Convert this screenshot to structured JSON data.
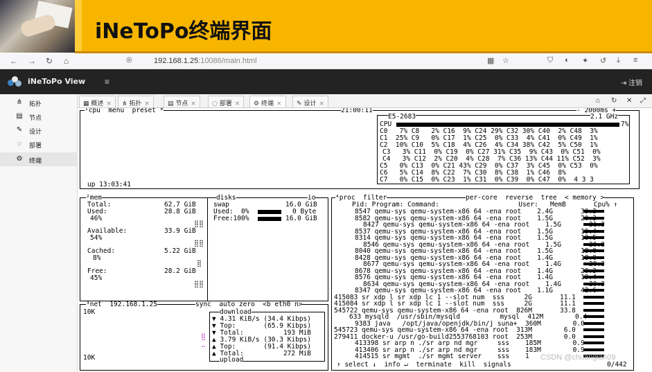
{
  "slide": {
    "title": "iNeToPo终端界面"
  },
  "browser": {
    "url_host": "192.168.1.25",
    "url_path": ":10086/main.html"
  },
  "app": {
    "title": "iNeToPo View",
    "logout": "注销"
  },
  "sidebar": {
    "items": [
      {
        "icon": "topology-icon",
        "label": "拓扑"
      },
      {
        "icon": "node-icon",
        "label": "节点"
      },
      {
        "icon": "design-icon",
        "label": "设计"
      },
      {
        "icon": "deploy-icon",
        "label": "部署"
      },
      {
        "icon": "terminal-icon",
        "label": "终端"
      }
    ]
  },
  "tabs": [
    {
      "label": "概述"
    },
    {
      "label": "拓扑"
    },
    {
      "label": "节点"
    },
    {
      "label": "部署"
    },
    {
      "label": "终端"
    },
    {
      "label": "设计"
    }
  ],
  "term": {
    "cpu_header": "¹cpu  menu  preset *",
    "clock": "21:00:11",
    "interval": "- 2000ms +",
    "cpu_model": "E5-2683",
    "cpu_freq": "2.1 GHz",
    "cpu_total_label": "CPU",
    "cpu_total_pct": "7%",
    "cpu_rows": [
      "C0   7% C8   2% C16  9% C24 29% C32 30% C40  2% C48  3%",
      "C1  25% C9   0% C17  1% C25  0% C33  4% C41  0% C49  1%",
      "C2  10% C10  5% C18  4% C26  4% C34 38% C42  5% C50  1%",
      "C3   3% C11  0% C19  0% C27 31% C35  9% C43  0% C51  0%",
      "C4   3% C12  2% C20  4% C28  7% C36 13% C44 11% C52  3%",
      "C5   0% C13  0% C21 43% C29  0% C37  3% C45  0% C53  0%",
      "C6   5% C14  8% C22  7% C30  8% C38  1% C46  8%",
      "C7   0% C15  0% C23  1% C31  0% C39  0% C47  0%  4 3 3"
    ],
    "uptime": "up 13:03:41",
    "mem_header": "²mem",
    "disks_header": "disks",
    "io_header": "io",
    "mem_rows": [
      {
        "label": "Total:",
        "value": "62.7 GiB"
      },
      {
        "label": "Used:",
        "value": "28.8 GiB",
        "pct": "46%"
      },
      {
        "label": "Available:",
        "value": "33.9 GiB",
        "pct": "54%"
      },
      {
        "label": "Cached:",
        "value": "5.22 GiB",
        "pct": "8%"
      },
      {
        "label": "Free:",
        "value": "28.2 GiB",
        "pct": "45%"
      }
    ],
    "swap_label": "swap",
    "swap_total": "16.0 GiB",
    "swap_used": "Used:  0%",
    "swap_used_val": "0 Byte",
    "swap_free": "Free:100%",
    "swap_free_val": "16.0 GiB",
    "net_header": "³net  192.168.1.25",
    "net_opts": "sync  auto zero  <b eth0 n>",
    "net_top_scale": "10K",
    "net_bottom_scale": "10K",
    "download_label": "download",
    "upload_label": "upload",
    "net_rows": [
      "▼ 4.31 KiB/s (34.4 Kibps)",
      "▼ Top:       (65.9 Kibps)",
      "▼ Total:          193 MiB",
      "▲ 3.79 KiB/s (30.3 Kibps)",
      "▲ Top:       (91.4 Kibps)",
      "▲ Total:          272 MiB"
    ],
    "proc_header": "⁴proc  filter",
    "proc_opts": "per-core  reverse  tree  < memory >",
    "proc_columns": "Pid: Program: Command:                    User:   MemB       Cpu% ↑",
    "proc_rows": [
      "8547 qemu-sys qemu-system-x86 64 -ena root    2.4G       39.3",
      "8582 qemu-sys qemu-system-x86 64 -ena root    1.5G       20.3",
      "8427 qemu-sys qemu-system-x86 64 -ena root    1.5G       21.3",
      "8537 qemu-sys qemu-system-x86 64 -ena root    1.5G       19.4",
      "8314 qemu-sys qemu-system-x86 64 -ena root    1.5G       18.5",
      "8546 qemu-sys qemu-system-x86 64 -ena root    1.5G       20.8",
      "8040 qemu-sys qemu-system-x86 64 -ena root    1.5G       18.0",
      "8428 qemu-sys qemu-system-x86 64 -ena root    1.4G       18.0",
      "8677 qemu-sys qemu-system-x86 64 -ena root    1.4G       20.3",
      "8678 qemu-sys qemu-system-x86 64 -ena root    1.4G       20.3",
      "8576 qemu-sys qemu-system-x86 64 -ena root    1.4G       19.4",
      "8634 qemu-sys qemu-system-x86 64 -ena root    1.4G       20.3",
      "8347 qemu-sys qemu-system-x86 64 -ena root    1.1G       42.6",
      "415083 sr xdp l sr xdp lc 1 --slot num  sss     2G       11.1",
      "415084 sr xdp l sr xdp lc 1 --slot num  sss     2G       11.1",
      "545722 qemu-sys qemu-system-x86 64 -ena root  826M       33.8",
      "633 mysqld  /usr/sbin/mysqld          mysql  412M        0.4",
      "9383 java   /opt/java/openjdk/bin/j suna+  360M        0.0",
      "545723 qemu-sys qemu-system-x86 64 -ena root  313M        6.0",
      "279411 docker-u /usr/go-build2553768103 root  253M        0.0",
      "413398 sr arp n ./sr arp nd mgr     sss    185M        0.9",
      "413406 sr arp n ./sr arp nd mgr     sss    183M        0.9",
      "414515 sr mgmt  ./sr mgmt server    sss    1"
    ],
    "proc_footer": "↑ select ↓  info ↵  terminate  kill  signals",
    "proc_count": "0/442"
  },
  "watermark": "CSDN @chuanglan09"
}
